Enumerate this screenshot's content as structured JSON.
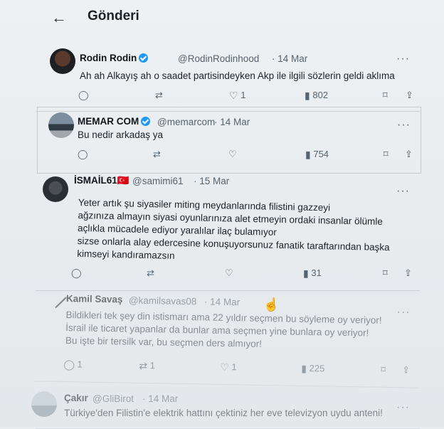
{
  "header": {
    "back_icon": "arrow-left-icon",
    "title": "Gönderi"
  },
  "posts": [
    {
      "name": "Rodin Rodin",
      "handle": "@RodinRodinhood",
      "date": "· 14 Mar",
      "text": "Ah ah Alkayış ah o saadet partisindeyken Akp ile ilgili sözlerin geldi aklıma",
      "likes": "1",
      "views": "802",
      "verified": true
    },
    {
      "name": "MEMAR COM",
      "handle": "@memarcom",
      "date": "· 14 Mar",
      "text": "Bu nedir arkadaş ya",
      "views": "754",
      "verified": true
    },
    {
      "name": "İSMAİL61🇹🇷",
      "handle": "@samimi61",
      "date": "· 15 Mar",
      "lines": [
        "Yeter artık şu siyasiler miting meydanlarında filistini gazzeyi",
        "ağzınıza almayın siyasi oyunlarınıza alet etmeyin ordaki insanlar ölümle",
        "açlıkla mücadele ediyor yaralılar ilaç bulamıyor",
        "sizse onlarla alay edercesine konuşuyorsunuz fanatik taraftarından başka",
        "kimseyi kandıramazsın"
      ],
      "views": "31"
    },
    {
      "name": "Kamil Savaş",
      "handle": "@kamilsavas08",
      "date": "· 14 Mar",
      "lines": [
        "Bildikleri tek şey din istismarı ama 22 yıldır seçmen bu söyleme oy veriyor!",
        "İsrail ile ticaret yapanlar da bunlar ama seçmen yine bunlara oy veriyor!",
        "Bu işte bir tersilk var, bu seçmen ders almıyor!"
      ],
      "replies": "1",
      "retweets": "1",
      "likes": "1",
      "views": "225"
    },
    {
      "name": "Çakır",
      "handle": "@GliBirot",
      "date": "· 14 Mar",
      "text": "Türkiye'den Filistin'e elektrik hattını çektiniz her eve televizyon uydu anteni!"
    }
  ]
}
